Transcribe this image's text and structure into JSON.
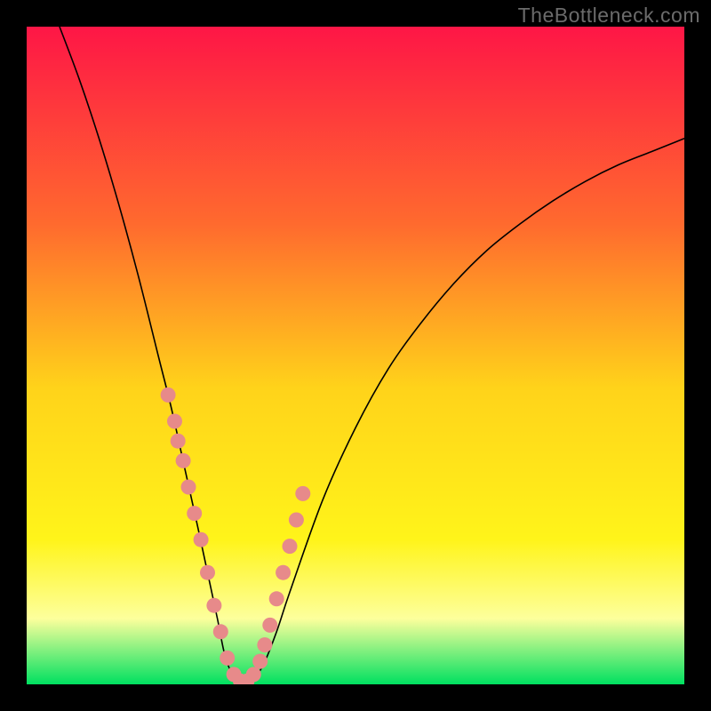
{
  "attribution": "TheBottleneck.com",
  "colors": {
    "black": "#000000",
    "gradient_top": "#fe1646",
    "gradient_mid1": "#ff6a2e",
    "gradient_mid2": "#ffd31a",
    "gradient_mid3": "#fff41a",
    "gradient_mid4": "#fdff9c",
    "gradient_bottom": "#00e060",
    "dot": "#e78a8a",
    "curve": "#000000"
  },
  "chart_data": {
    "type": "line",
    "title": "",
    "xlabel": "",
    "ylabel": "",
    "xlim": [
      0,
      100
    ],
    "ylim": [
      0,
      100
    ],
    "series": [
      {
        "name": "bottleneck-curve",
        "x": [
          5,
          8,
          11,
          14,
          17,
          20,
          22,
          24,
          26,
          27.5,
          29,
          30,
          31,
          32,
          33,
          34.5,
          36,
          38,
          40,
          45,
          50,
          55,
          60,
          65,
          70,
          75,
          80,
          85,
          90,
          95,
          100
        ],
        "y": [
          100,
          92,
          83,
          73,
          62,
          50,
          42,
          33,
          24,
          17,
          10,
          5,
          2,
          0.5,
          0.5,
          1,
          3,
          8,
          14,
          28,
          39,
          48,
          55,
          61,
          66,
          70,
          73.5,
          76.5,
          79,
          81,
          83
        ]
      }
    ],
    "scatter_points": {
      "name": "highlight-dots",
      "x": [
        21.5,
        22.5,
        23.0,
        23.8,
        24.6,
        25.5,
        26.5,
        27.5,
        28.5,
        29.5,
        30.5,
        31.5,
        32.5,
        33.5,
        34.5,
        35.5,
        36.2,
        37.0,
        38.0,
        39.0,
        40.0,
        41.0,
        42.0
      ],
      "y": [
        44,
        40,
        37,
        34,
        30,
        26,
        22,
        17,
        12,
        8,
        4,
        1.5,
        0.5,
        0.5,
        1.5,
        3.5,
        6,
        9,
        13,
        17,
        21,
        25,
        29
      ]
    }
  }
}
